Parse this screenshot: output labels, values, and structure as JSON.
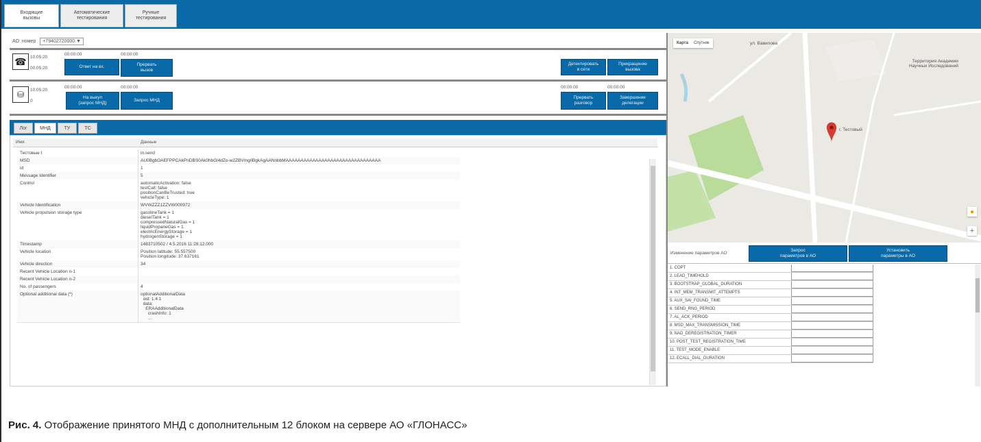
{
  "top_tabs": [
    "Входящие\nвызовы",
    "Автоматические\nтестирования",
    "Ручные\nтестирования"
  ],
  "ao_row": {
    "label": "АО: номер",
    "selected": "+79402720000 ▼"
  },
  "call1": {
    "time1": "10:05:20",
    "time2": "00:05:20",
    "t_a": "00:00:00",
    "t_b": "00:00:00",
    "btn_answer": "Ответ на вх.",
    "btn_end": "Прервать\nвызов",
    "btn_right1": "Детектировать\nв сети",
    "btn_right2": "Прекращение\nвызова"
  },
  "call2": {
    "time1": "10:05:20",
    "sub": "0",
    "t_a": "00:00:00",
    "t_b": "00:00:00",
    "t_c": "00:00:00",
    "t_d": "00:00:00",
    "btn1": "На выкуп\n(запрос МНД)",
    "btn2": "Запрос МНД",
    "btn_right1": "Прервать\nразговор",
    "btn_right2": "Завершение\nделегации"
  },
  "detail_tabs": [
    "Лог",
    "МНД",
    "ТУ",
    "ТС"
  ],
  "table": {
    "col_name": "Имя",
    "col_value": "Данные",
    "rows": [
      {
        "k": "Тестовые t",
        "v": "in.send"
      },
      {
        "k": "MSD",
        "v": "AU0BgbOAEFPPCAkPnDBS0Ak0hbGl4dZo-w2ZBVmg/iBgkAgAANnbbMAAAAAAAAAAAAAAAAAAAAAAAAAAAAAAAA"
      },
      {
        "k": "id",
        "v": "1"
      },
      {
        "k": "Message Identifier",
        "v": "5"
      },
      {
        "k": "Control",
        "v": "automaticActivation: false\ntestCall: false\npositionCanBeTrusted: true\nvehicleType: 1"
      },
      {
        "k": "Vehicle Identification",
        "v": "WVWZZZ1ZZVW000972"
      },
      {
        "k": "Vehicle propulsion storage type",
        "v": "gasolineTank = 1\ndieselTank = 1\ncompressedNaturalGas = 1\nliquidPropaneGas = 1\nelectricEnergyStorage = 1\nhydrogenStorage = 1"
      },
      {
        "k": "Timestamp",
        "v": "1483710502 / 4.5.2016 11:28:12.000"
      },
      {
        "k": "Vehicle location",
        "v": "Position latitude: 55.557500\nPosition longitude: 37.637161"
      },
      {
        "k": "Vehicle direction",
        "v": "34"
      },
      {
        "k": "Recent Vehicle Location n-1",
        "v": ""
      },
      {
        "k": "Recent Vehicle Location n-2",
        "v": ""
      },
      {
        "k": "No. of passengers",
        "v": "4"
      },
      {
        "k": "Optional additional data (*)",
        "v": "optionalAdditionalData\n  oid: 1.4.1\n  data:\n    ERAAdditionalData\n      crashInfo: 1\n      ..."
      }
    ]
  },
  "map": {
    "tab_map": "Карта",
    "tab_sat": "Спутник",
    "label_street": "ул. Вавилова",
    "label_place": "Территория Академии\nНаучных Исследований",
    "marker_label": "г. Тестовый",
    "zoom_in": "+"
  },
  "params": {
    "title": "Изменение параметров АО",
    "btn1": "Запрос\nпараметров в АО",
    "btn2": "Установить\nпараметры в АО",
    "items": [
      "1. COPT",
      "2. LEAD_TIMEHOLD",
      "3. BOOTSTRAP_GLOBAL_DURATION",
      "4. INT_MEM_TRANSMIT_ATTEMPTS",
      "5. AUX_SAI_FOUND_TIME",
      "6. SEND_RNG_PERIOD",
      "7. AL_ACK_PERIOD",
      "8. MSD_MAX_TRANSMISSION_TIME",
      "9. NAD_DEREGISTRATION_TIMER",
      "10. POST_TEST_REGISTRATION_TIME",
      "11. TEST_MODE_ENABLE",
      "12. ECALL_DIAL_DURATION"
    ]
  },
  "caption": {
    "bold": "Рис. 4.",
    "text": " Отображение принятого МНД с дополнительным 12 блоком на сервере АО «ГЛОНАСС»"
  },
  "colors": {
    "accent": "#0a6aa8",
    "park": "#b9dc9a",
    "marker": "#d63a2f"
  }
}
